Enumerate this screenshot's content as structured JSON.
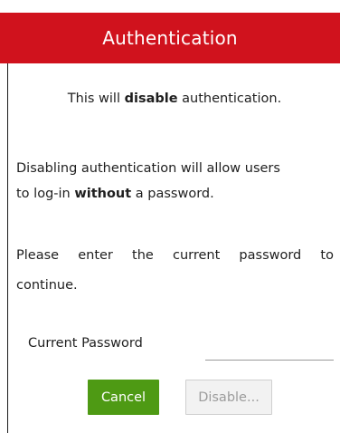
{
  "dialog": {
    "title": "Authentication",
    "header_color": "#d0121d"
  },
  "message": {
    "line1_prefix": "This will ",
    "line1_bold": "disable",
    "line1_suffix": " authentication.",
    "line2": "Disabling authentication will allow users",
    "line3_prefix": "to log-in ",
    "line3_bold": "without",
    "line3_suffix": " a password.",
    "line4_words": [
      "Please",
      "enter",
      "the",
      "current",
      "password",
      "to"
    ],
    "line5": "continue."
  },
  "form": {
    "password_label": "Current Password",
    "password_value": ""
  },
  "buttons": {
    "cancel_label": "Cancel",
    "cancel_color": "#4e9a14",
    "disable_label": "Disable...",
    "disable_state": "disabled"
  }
}
